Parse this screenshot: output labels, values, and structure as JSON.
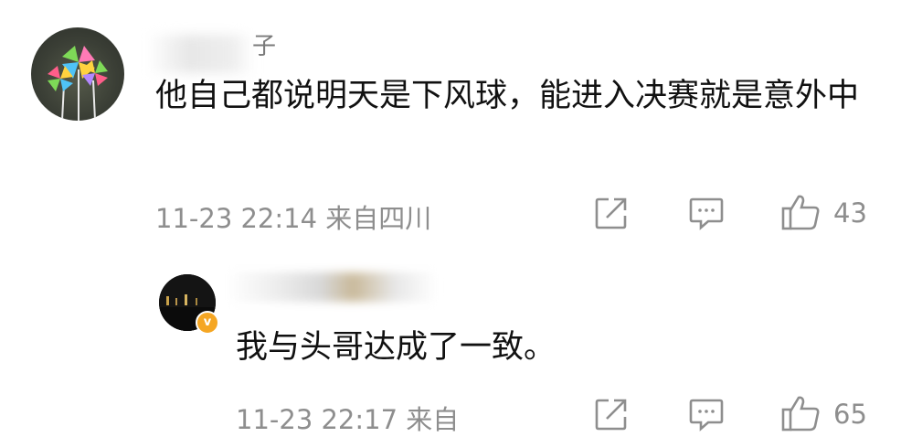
{
  "comments": [
    {
      "username_visible": "子",
      "text": "他自己都说明天是下风球，能进入决赛就是意外中",
      "time": "11-23 22:14",
      "location": "来自四川",
      "likes": "43"
    },
    {
      "badge": "v",
      "text": "我与头哥达成了一致。",
      "time": "11-23 22:17",
      "location": "来自",
      "likes": "65"
    }
  ],
  "icons": {
    "share": "share-icon",
    "comment": "comment-icon",
    "like": "thumbs-up-icon"
  }
}
